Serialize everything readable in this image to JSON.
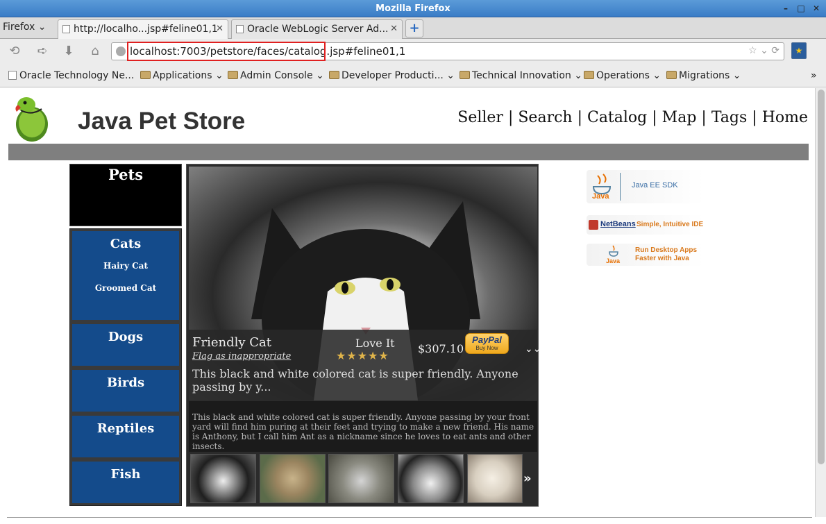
{
  "window": {
    "title": "Mozilla Firefox",
    "buttons": [
      "–",
      "□",
      "✕"
    ]
  },
  "tabs": {
    "menu_label": "Firefox",
    "items": [
      {
        "label": "http://localho...jsp#feline01,1",
        "active": true
      },
      {
        "label": "Oracle WebLogic Server Ad...",
        "active": false
      }
    ],
    "new_tab": "+"
  },
  "nav": {
    "url": "localhost:7003/petstore/faces/catalog.jsp#feline01,1"
  },
  "bookmarks": [
    {
      "label": "Oracle Technology Ne...",
      "type": "page"
    },
    {
      "label": "Applications",
      "type": "folder"
    },
    {
      "label": "Admin Console",
      "type": "folder"
    },
    {
      "label": "Developer Producti...",
      "type": "folder"
    },
    {
      "label": "Technical Innovation",
      "type": "folder"
    },
    {
      "label": "Operations",
      "type": "folder"
    },
    {
      "label": "Migrations",
      "type": "folder"
    }
  ],
  "site": {
    "title": "Java Pet Store",
    "nav": [
      "Seller",
      "Search",
      "Catalog",
      "Map",
      "Tags",
      "Home"
    ]
  },
  "menu": {
    "header": "Pets",
    "categories": [
      {
        "title": "Cats",
        "subs": [
          "Hairy Cat",
          "Groomed Cat"
        ]
      },
      {
        "title": "Dogs"
      },
      {
        "title": "Birds"
      },
      {
        "title": "Reptiles"
      },
      {
        "title": "Fish"
      }
    ]
  },
  "item": {
    "name": "Friendly Cat",
    "flag_link": "Flag as inappropriate",
    "love_label": "Love It",
    "rating": 5,
    "stars": "★★★★★",
    "price": "$307.10",
    "paypal_logo": "PayPal",
    "paypal_sub": "Buy Now",
    "short_description": "This black and white colored cat is super friendly. Anyone passing by y...",
    "long_description": "This black and white colored cat is super friendly. Anyone passing by your front yard will find him puring at their feet and trying to make a new friend. His name is Anthony, but I call him Ant as a nickname since he loves to eat ants and other insects."
  },
  "ads": {
    "java": {
      "logo": "Java",
      "text": "Java EE SDK"
    },
    "netbeans": {
      "logo": "NetBeans",
      "text": "Simple, Intuitive IDE"
    },
    "desktop": {
      "logo": "Java",
      "line1": "Run Desktop Apps",
      "line2": "Faster with Java"
    }
  },
  "colors": {
    "category_blue": "#144b8b",
    "accent_red": "#e02020",
    "ad_orange": "#d9781a"
  }
}
